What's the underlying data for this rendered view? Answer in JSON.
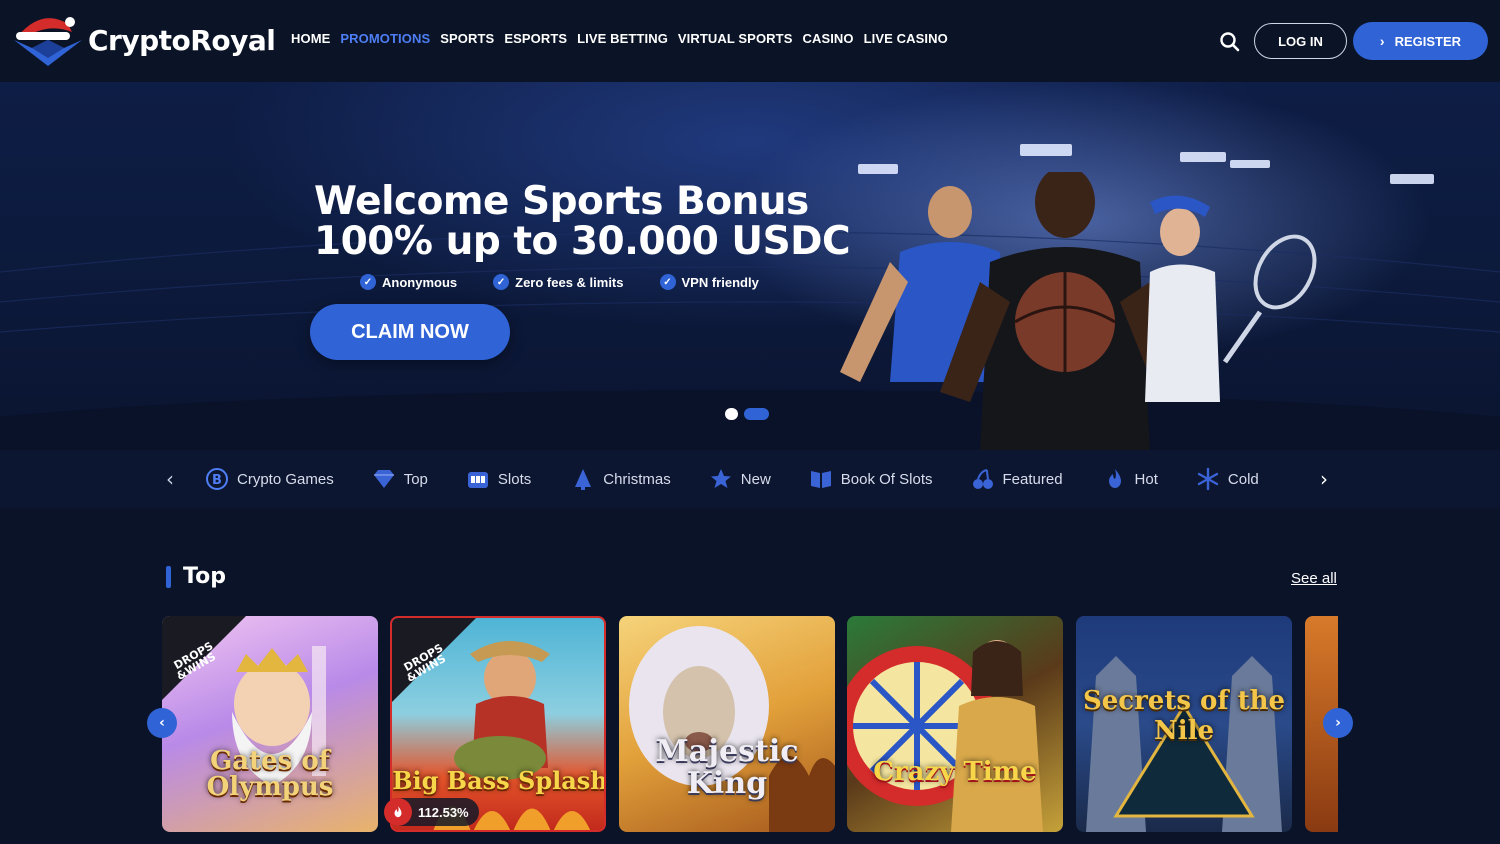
{
  "brand": {
    "name": "CryptoRoyal",
    "accent": "#2f63d6"
  },
  "nav": {
    "items": [
      {
        "label": "HOME",
        "active": false
      },
      {
        "label": "PROMOTIONS",
        "active": true
      },
      {
        "label": "SPORTS",
        "active": false
      },
      {
        "label": "ESPORTS",
        "active": false
      },
      {
        "label": "LIVE BETTING",
        "active": false
      },
      {
        "label": "VIRTUAL SPORTS",
        "active": false
      },
      {
        "label": "CASINO",
        "active": false
      },
      {
        "label": "LIVE CASINO",
        "active": false
      }
    ]
  },
  "header": {
    "search_icon": "search-icon",
    "login_label": "LOG IN",
    "register_label": "REGISTER"
  },
  "banner": {
    "title_line1": "Welcome Sports Bonus",
    "title_line2": "100% up to 30.000 USDC",
    "features": [
      "Anonymous",
      "Zero fees & limits",
      "VPN friendly"
    ],
    "cta_label": "CLAIM NOW",
    "slides": {
      "count": 2,
      "active": 2
    }
  },
  "categories": [
    {
      "label": "Crypto Games",
      "icon": "bitcoin-icon"
    },
    {
      "label": "Top",
      "icon": "diamond-icon"
    },
    {
      "label": "Slots",
      "icon": "slot-machine-icon"
    },
    {
      "label": "Christmas",
      "icon": "christmas-tree-icon"
    },
    {
      "label": "New",
      "icon": "star-icon"
    },
    {
      "label": "Book Of Slots",
      "icon": "book-icon"
    },
    {
      "label": "Featured",
      "icon": "cherries-icon"
    },
    {
      "label": "Hot",
      "icon": "flame-icon"
    },
    {
      "label": "Cold",
      "icon": "snowflake-icon"
    }
  ],
  "section": {
    "title": "Top",
    "see_all": "See all",
    "games": [
      {
        "title": "Gates of Olympus",
        "badge": "DROPS & WINS"
      },
      {
        "title": "Big Bass Splash",
        "badge": "DROPS & WINS",
        "hot_pct": "112.53%"
      },
      {
        "title": "Majestic King"
      },
      {
        "title": "Crazy Time"
      },
      {
        "title": "Secrets of the Nile"
      }
    ]
  }
}
